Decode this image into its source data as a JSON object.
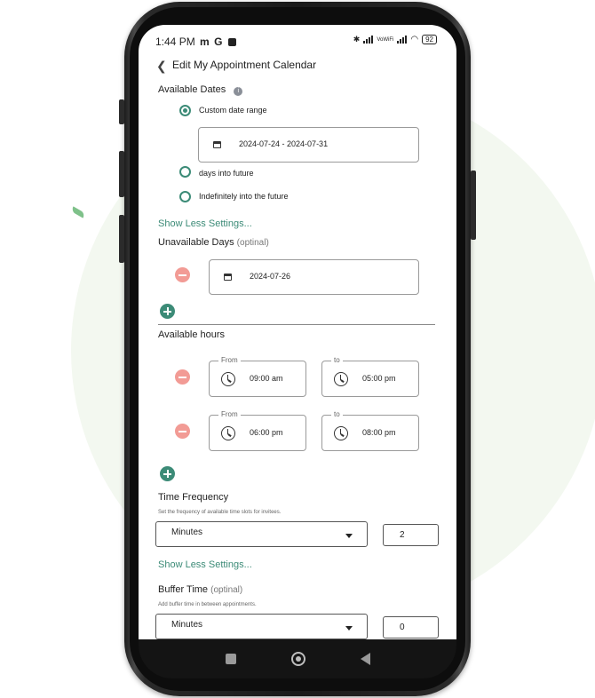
{
  "status_bar": {
    "time": "1:44 PM",
    "icons": [
      "m",
      "G",
      "notification-icon"
    ],
    "network": "VoWiFi",
    "battery": "92"
  },
  "header": {
    "title": "Edit My Appointment Calendar"
  },
  "available_dates": {
    "title": "Available Dates",
    "options": [
      {
        "label": "Custom date range",
        "selected": true
      },
      {
        "label": "days into future",
        "selected": false
      },
      {
        "label": "Indefinitely into the future",
        "selected": false
      }
    ],
    "date_range_value": "2024-07-24 - 2024-07-31",
    "show_less_label": "Show Less Settings..."
  },
  "unavailable_days": {
    "title": "Unavailable Days",
    "optional_label": "(optinal)",
    "dates": [
      "2024-07-26"
    ]
  },
  "available_hours": {
    "title": "Available hours",
    "from_label": "From",
    "to_label": "to",
    "slots": [
      {
        "from": "09:00 am",
        "to": "05:00 pm"
      },
      {
        "from": "06:00 pm",
        "to": "08:00 pm"
      }
    ]
  },
  "time_frequency": {
    "title": "Time Frequency",
    "helper": "Set the frequency of available time slots for invitees.",
    "unit": "Minutes",
    "value": "2",
    "show_less_label": "Show Less Settings..."
  },
  "buffer_time": {
    "title": "Buffer Time",
    "optional_label": "(optinal)",
    "helper": "Add buffer time in between appointments.",
    "unit": "Minutes",
    "value": "0"
  },
  "colors": {
    "accent": "#3c8b77",
    "remove": "#f29b95",
    "background_circle": "#f3f8f0"
  }
}
